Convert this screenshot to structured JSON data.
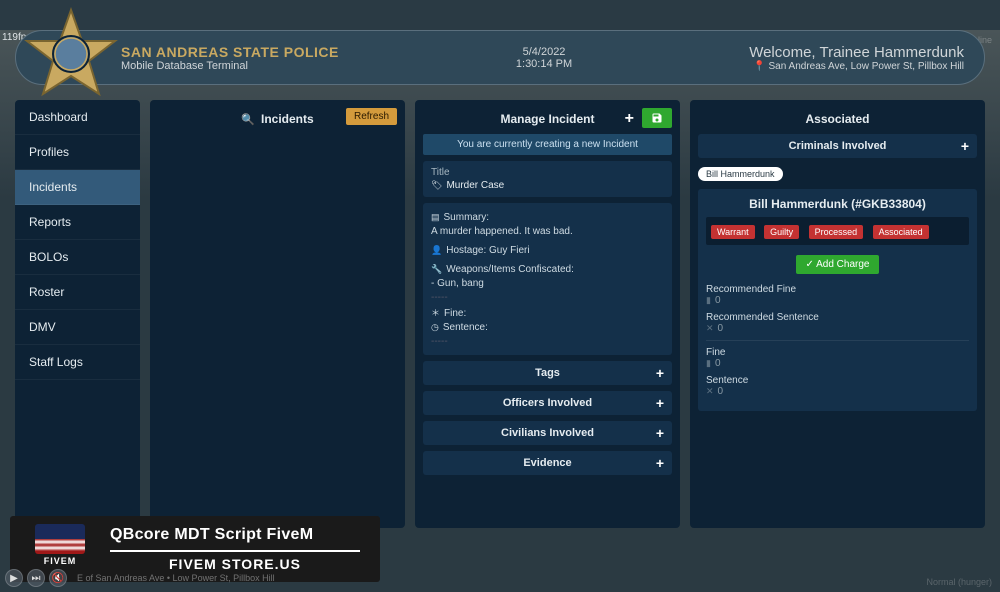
{
  "fps": "119fps",
  "video_label": "Radeon ReLive: Off-line",
  "footer_location": "E of San Andreas Ave • Low Power St, Pillbox Hill",
  "normal_label": "Normal (hunger)",
  "header": {
    "title": "SAN ANDREAS STATE POLICE",
    "subtitle": "Mobile Database Terminal",
    "date": "5/4/2022",
    "time": "1:30:14 PM",
    "welcome": "Welcome, Trainee Hammerdunk",
    "location": "San Andreas Ave, Low Power St, Pillbox Hill"
  },
  "sidebar": {
    "items": [
      "Dashboard",
      "Profiles",
      "Incidents",
      "Reports",
      "BOLOs",
      "Roster",
      "DMV",
      "Staff Logs"
    ],
    "active_index": 2
  },
  "incidents_panel": {
    "title": "Incidents",
    "refresh": "Refresh"
  },
  "manage": {
    "title": "Manage Incident",
    "notice": "You are currently creating a new Incident",
    "title_label": "Title",
    "title_value": "Murder Case",
    "summary_label": "Summary:",
    "lines": {
      "l1": "A murder happened. It was bad.",
      "l2_label": "Hostage:",
      "l2_val": "Guy Fieri",
      "l3_label": "Weapons/Items Confiscated:",
      "l4": "- Gun, bang",
      "sep1": "-----",
      "fine": "Fine:",
      "sentence": "Sentence:",
      "sep2": "-----"
    },
    "sections": [
      "Tags",
      "Officers Involved",
      "Civilians Involved",
      "Evidence"
    ]
  },
  "associated": {
    "title": "Associated",
    "criminals_head": "Criminals Involved",
    "chip": "Bill Hammerdunk",
    "criminal": {
      "name": "Bill Hammerdunk (#GKB33804)",
      "statuses": [
        "Warrant",
        "Guilty",
        "Processed",
        "Associated"
      ],
      "add_charge": "Add Charge",
      "rec_fine_label": "Recommended Fine",
      "rec_fine_val": "0",
      "rec_sentence_label": "Recommended Sentence",
      "rec_sentence_val": "0",
      "fine_label": "Fine",
      "fine_val": "0",
      "sentence_label": "Sentence",
      "sentence_val": "0"
    }
  },
  "watermark": {
    "title": "QBcore MDT Script FiveM",
    "sub": "FIVEM STORE.US",
    "logo": "FIVEM"
  },
  "colors": {
    "panel_bg": "#0d2235",
    "field_bg": "#14304a",
    "accent_gold": "#c9a961",
    "green": "#2fa82f",
    "orange": "#d49b3c",
    "red": "#c43232"
  }
}
